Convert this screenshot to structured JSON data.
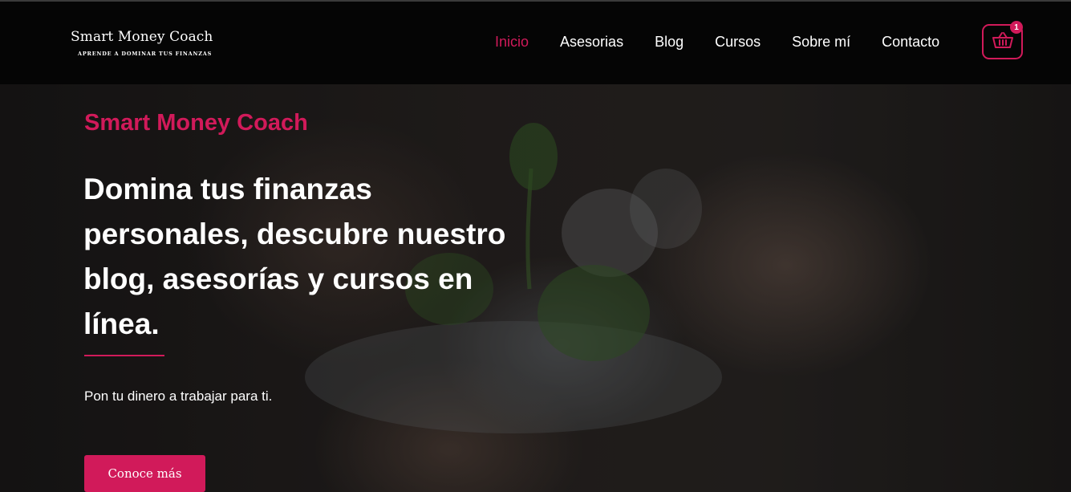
{
  "brand": {
    "title": "Smart Money Coach",
    "subtitle": "APRENDE A DOMINAR TUS FINANZAS"
  },
  "nav": {
    "items": [
      {
        "label": "Inicio",
        "active": true
      },
      {
        "label": "Asesorias",
        "active": false
      },
      {
        "label": "Blog",
        "active": false
      },
      {
        "label": "Cursos",
        "active": false
      },
      {
        "label": "Sobre mí",
        "active": false
      },
      {
        "label": "Contacto",
        "active": false
      }
    ]
  },
  "cart": {
    "icon": "basket-icon",
    "count": "1"
  },
  "hero": {
    "eyebrow": "Smart Money Coach",
    "headline": "Domina tus finanzas personales, descubre nuestro blog, asesorías y cursos en línea.",
    "tagline": "Pon tu dinero a trabajar para ti.",
    "cta_label": "Conoce más"
  },
  "colors": {
    "accent": "#d11a5a",
    "navbar_bg": "#050505",
    "text": "#ffffff"
  }
}
